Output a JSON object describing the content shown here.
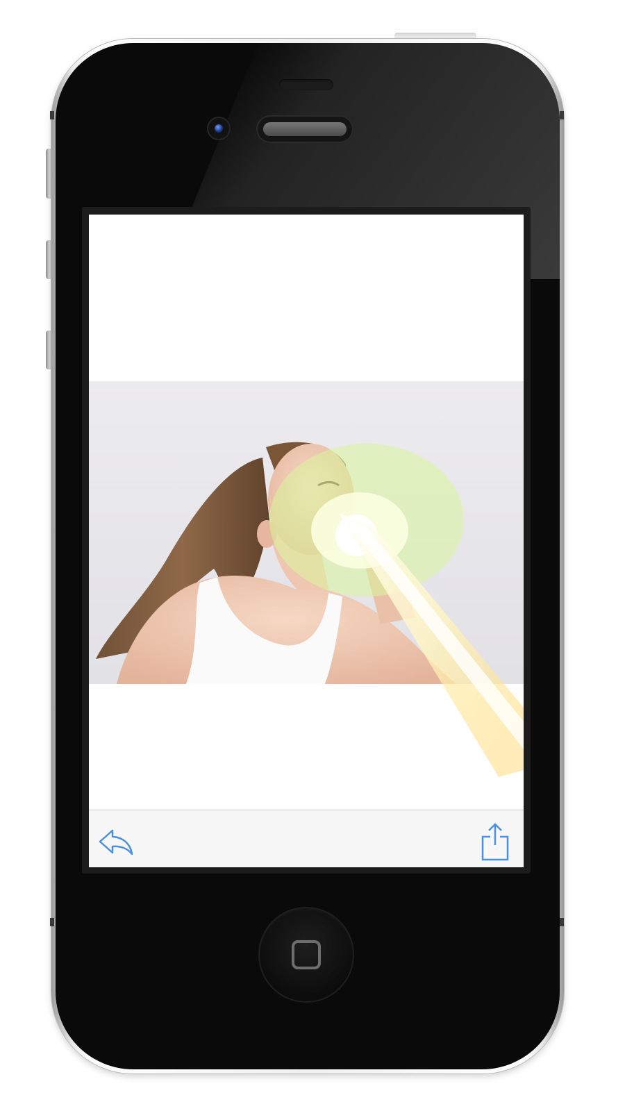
{
  "device": {
    "model": "iPhone",
    "body_color": "#0a0a0a",
    "frame_color": "#eeeeee"
  },
  "toolbar": {
    "back_icon": "reply-arrow-icon",
    "share_icon": "share-icon",
    "icon_color": "#4a90e2"
  },
  "photo": {
    "subject": "woman-breathing-light-beam",
    "beam_color": "#ffe98a",
    "glow_color": "#d8f59a"
  }
}
